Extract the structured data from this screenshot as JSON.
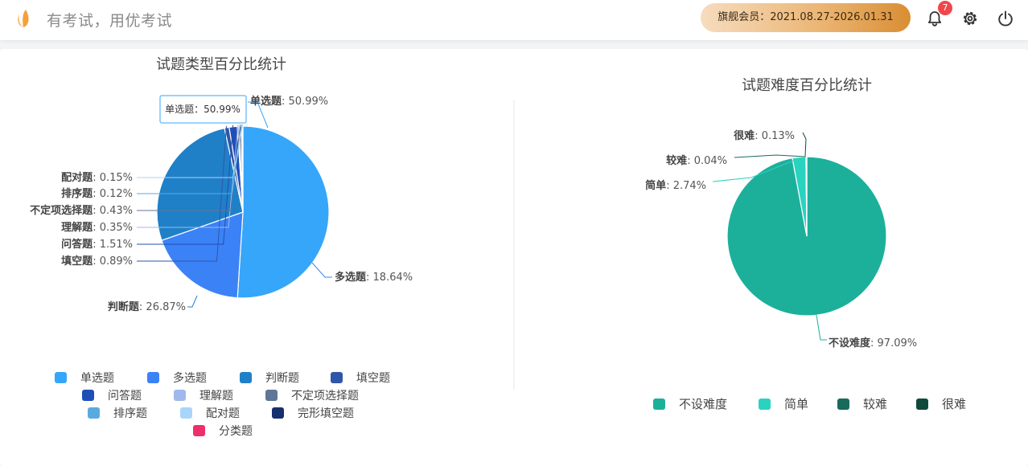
{
  "header": {
    "slogan": "有考试，用优考试",
    "membership": "旗舰会员：2021.08.27-2026.01.31",
    "notification_count": "7"
  },
  "colors": {
    "accent_orange": "#f5a03c",
    "badge_red": "#f0474b",
    "member_gradient_start": "#f6dcbf",
    "member_gradient_end": "#d98e33"
  },
  "chart_data": [
    {
      "type": "pie",
      "title": "试题类型百分比统计",
      "tooltip": "单选题：50.99%",
      "slices": [
        {
          "name": "单选题",
          "value": 50.99,
          "color": "#36a6fa"
        },
        {
          "name": "多选题",
          "value": 18.64,
          "color": "#3b82f7"
        },
        {
          "name": "判断题",
          "value": 26.87,
          "color": "#1f80c8"
        },
        {
          "name": "填空题",
          "value": 0.89,
          "color": "#2f56a8"
        },
        {
          "name": "问答题",
          "value": 1.51,
          "color": "#1f4fb6"
        },
        {
          "name": "理解题",
          "value": 0.35,
          "color": "#9fb9ec"
        },
        {
          "name": "不定项选择题",
          "value": 0.43,
          "color": "#5f7696"
        },
        {
          "name": "排序题",
          "value": 0.12,
          "color": "#5aaae0"
        },
        {
          "name": "配对题",
          "value": 0.15,
          "color": "#a8d6fb"
        },
        {
          "name": "完形填空题",
          "value": 0,
          "color": "#16306e"
        },
        {
          "name": "分类题",
          "value": 0,
          "color": "#ef2f6a"
        }
      ],
      "labels": [
        {
          "name": "单选题",
          "text": "50.99%"
        },
        {
          "name": "多选题",
          "text": "18.64%"
        },
        {
          "name": "判断题",
          "text": "26.87%"
        },
        {
          "name": "填空题",
          "text": "0.89%"
        },
        {
          "name": "问答题",
          "text": "1.51%"
        },
        {
          "name": "理解题",
          "text": "0.35%"
        },
        {
          "name": "不定项选择题",
          "text": "0.43%"
        },
        {
          "name": "排序题",
          "text": "0.12%"
        },
        {
          "name": "配对题",
          "text": "0.15%"
        }
      ],
      "legend": [
        "单选题",
        "多选题",
        "判断题",
        "填空题",
        "问答题",
        "理解题",
        "不定项选择题",
        "排序题",
        "配对题",
        "完形填空题",
        "分类题"
      ],
      "legend_placement": "bottom"
    },
    {
      "type": "pie",
      "title": "试题难度百分比统计",
      "slices": [
        {
          "name": "不设难度",
          "value": 97.09,
          "color": "#1cb09b"
        },
        {
          "name": "简单",
          "value": 2.74,
          "color": "#29d3c0"
        },
        {
          "name": "较难",
          "value": 0.04,
          "color": "#1a6a5c"
        },
        {
          "name": "很难",
          "value": 0.13,
          "color": "#0e4a3c"
        }
      ],
      "labels": [
        {
          "name": "不设难度",
          "text": "97.09%"
        },
        {
          "name": "简单",
          "text": "2.74%"
        },
        {
          "name": "较难",
          "text": "0.04%"
        },
        {
          "name": "很难",
          "text": "0.13%"
        }
      ],
      "legend": [
        "不设难度",
        "简单",
        "较难",
        "很难"
      ],
      "legend_placement": "bottom"
    }
  ]
}
